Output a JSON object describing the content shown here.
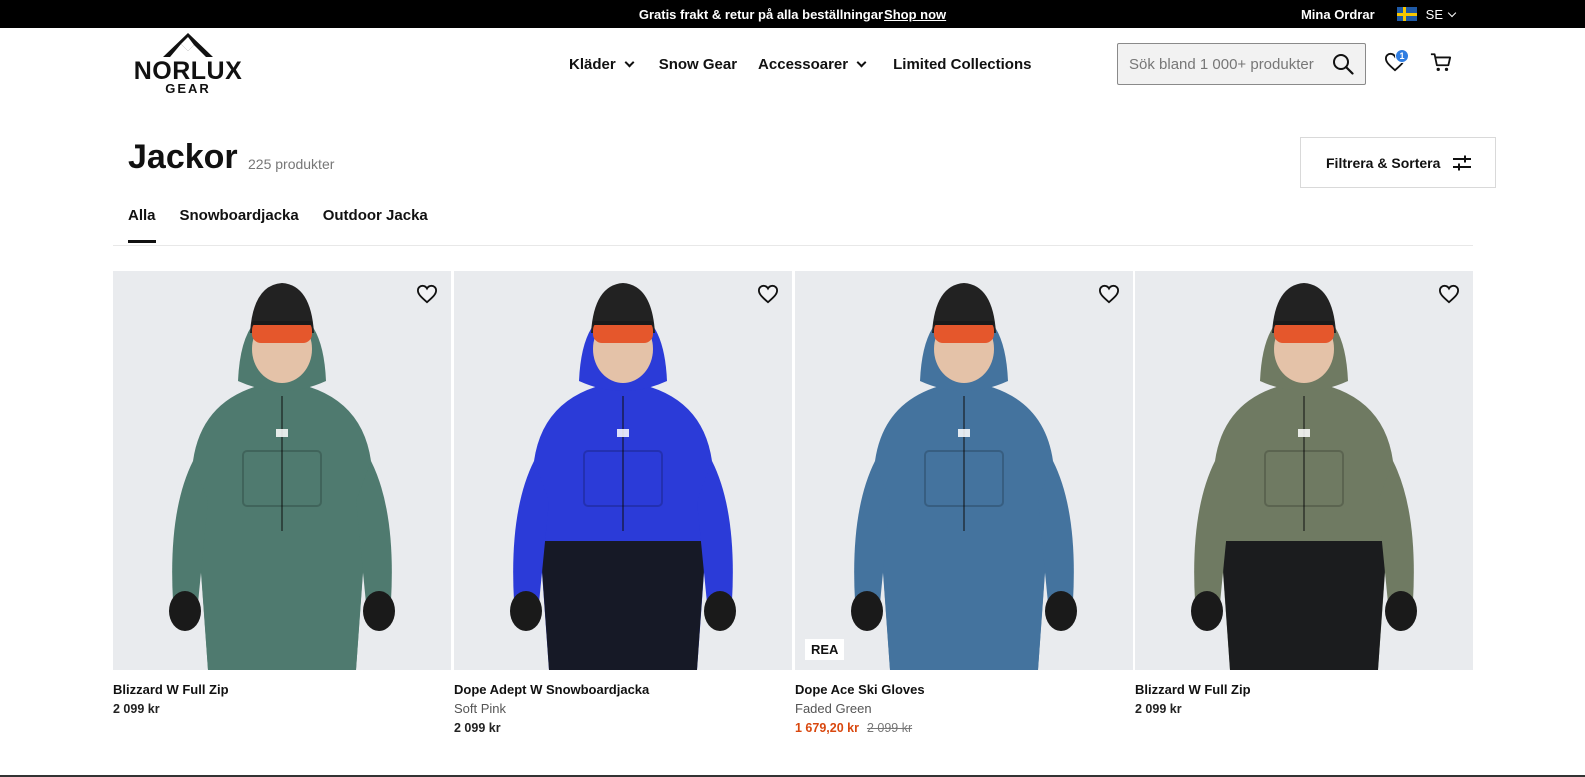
{
  "topbar": {
    "promo_text": "Gratis frakt & retur på alla beställningar",
    "promo_link": "Shop now",
    "orders": "Mina Ordrar",
    "language": "SE"
  },
  "logo": {
    "name": "NORLUX",
    "sub": "GEAR"
  },
  "nav": {
    "items": [
      {
        "label": "Kläder",
        "dropdown": true
      },
      {
        "label": "Snow Gear",
        "dropdown": false
      },
      {
        "label": "Accessoarer",
        "dropdown": true
      },
      {
        "label": "Limited Collections",
        "dropdown": false
      }
    ]
  },
  "search": {
    "placeholder": "Sök bland 1 000+ produkter"
  },
  "wishlist": {
    "count": "1"
  },
  "page": {
    "title": "Jackor",
    "count": "225 produkter",
    "filter_label": "Filtrera & Sortera"
  },
  "tabs": [
    {
      "label": "Alla",
      "active": true
    },
    {
      "label": "Snowboardjacka",
      "active": false
    },
    {
      "label": "Outdoor Jacka",
      "active": false
    }
  ],
  "products": [
    {
      "name": "Blizzard W Full Zip",
      "variant": "",
      "price": "2 099 kr",
      "original_price": "",
      "badge": "",
      "jacket_color": "#4f7a6f",
      "lower_color": "#4f7a6f"
    },
    {
      "name": "Dope Adept W Snowboardjacka",
      "variant": "Soft Pink",
      "price": "2 099 kr",
      "original_price": "",
      "badge": "",
      "jacket_color": "#2b3bd8",
      "lower_color": "#15171c"
    },
    {
      "name": "Dope Ace Ski Gloves",
      "variant": "Faded Green",
      "price": "1 679,20 kr",
      "original_price": "2 099 kr",
      "badge": "REA",
      "jacket_color": "#44739e",
      "lower_color": "#44739e"
    },
    {
      "name": "Blizzard W Full Zip",
      "variant": "",
      "price": "2 099 kr",
      "original_price": "",
      "badge": "",
      "jacket_color": "#6f7a62",
      "lower_color": "#16171a"
    }
  ],
  "colors": {
    "sale_price": "#d9480f",
    "badge_blue": "#2f7de1"
  }
}
